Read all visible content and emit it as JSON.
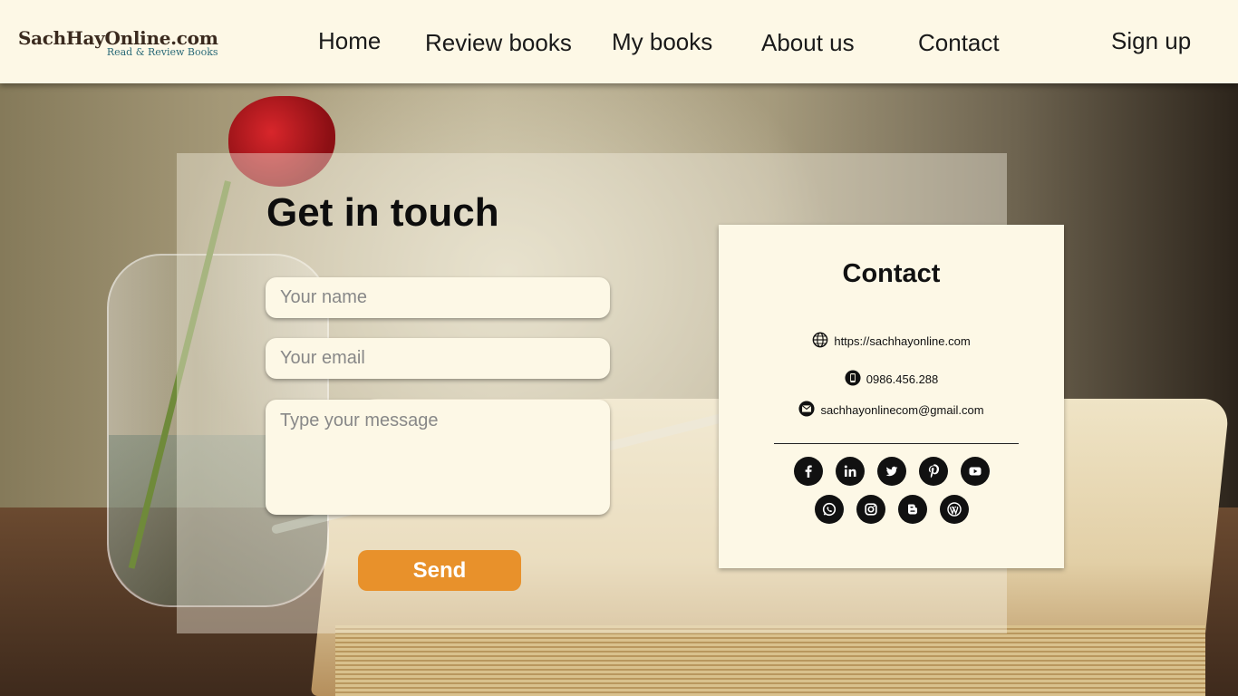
{
  "brand": {
    "name": "SachHayOnline.com",
    "tagline": "Read & Review Books"
  },
  "nav": {
    "items": [
      {
        "label": "Home"
      },
      {
        "label": "Review books"
      },
      {
        "label": "My books"
      },
      {
        "label": "About us"
      },
      {
        "label": "Contact"
      }
    ],
    "signup_label": "Sign up"
  },
  "form": {
    "title": "Get in touch",
    "name_placeholder": "Your name",
    "email_placeholder": "Your email",
    "message_placeholder": "Type your message",
    "send_label": "Send"
  },
  "contact": {
    "title": "Contact",
    "website": "https://sachhayonline.com",
    "phone": "0986.456.288",
    "email": "sachhayonlinecom@gmail.com",
    "social_row1": [
      "facebook-icon",
      "linkedin-icon",
      "twitter-icon",
      "pinterest-icon",
      "youtube-icon"
    ],
    "social_row2": [
      "whatsapp-icon",
      "instagram-icon",
      "blogger-icon",
      "wordpress-icon"
    ]
  },
  "colors": {
    "header_bg": "#fdf8e6",
    "accent": "#e8912b",
    "card_bg": "#fdf8e6"
  }
}
